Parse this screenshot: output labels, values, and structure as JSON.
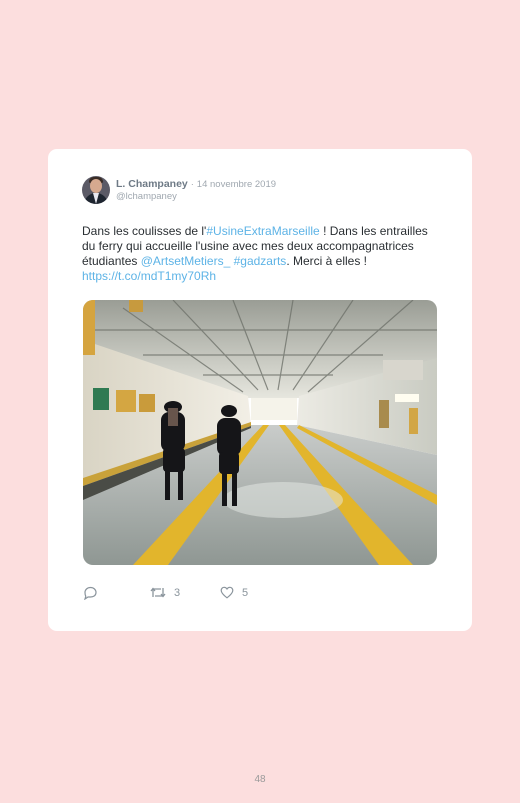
{
  "tweet": {
    "author_name": "L. Champaney",
    "separator": "·",
    "date": "14 novembre 2019",
    "handle": "@lchampaney",
    "text_parts": [
      {
        "type": "text",
        "value": "Dans les coulisses de l'"
      },
      {
        "type": "link",
        "value": "#UsineExtraMarseille"
      },
      {
        "type": "text",
        "value": " ! Dans les entrailles du ferry qui accueille l'usine avec mes deux accompagnatrices étudiantes "
      },
      {
        "type": "link",
        "value": "@ArtsetMetiers_"
      },
      {
        "type": "text",
        "value": " "
      },
      {
        "type": "link",
        "value": "#gadzarts"
      },
      {
        "type": "text",
        "value": ". Merci à elles ! "
      },
      {
        "type": "link",
        "value": "https://t.co/mdT1my70Rh"
      }
    ],
    "photo_description_icon": "photo-ferry-deck",
    "actions": {
      "reply_icon": "reply-icon",
      "retweet_icon": "retweet-icon",
      "retweet_count": "3",
      "like_icon": "heart-icon",
      "like_count": "5"
    },
    "colors": {
      "link": "#5db3e6",
      "background": "#fcdede",
      "card": "#ffffff"
    }
  },
  "page": {
    "number": "48"
  }
}
